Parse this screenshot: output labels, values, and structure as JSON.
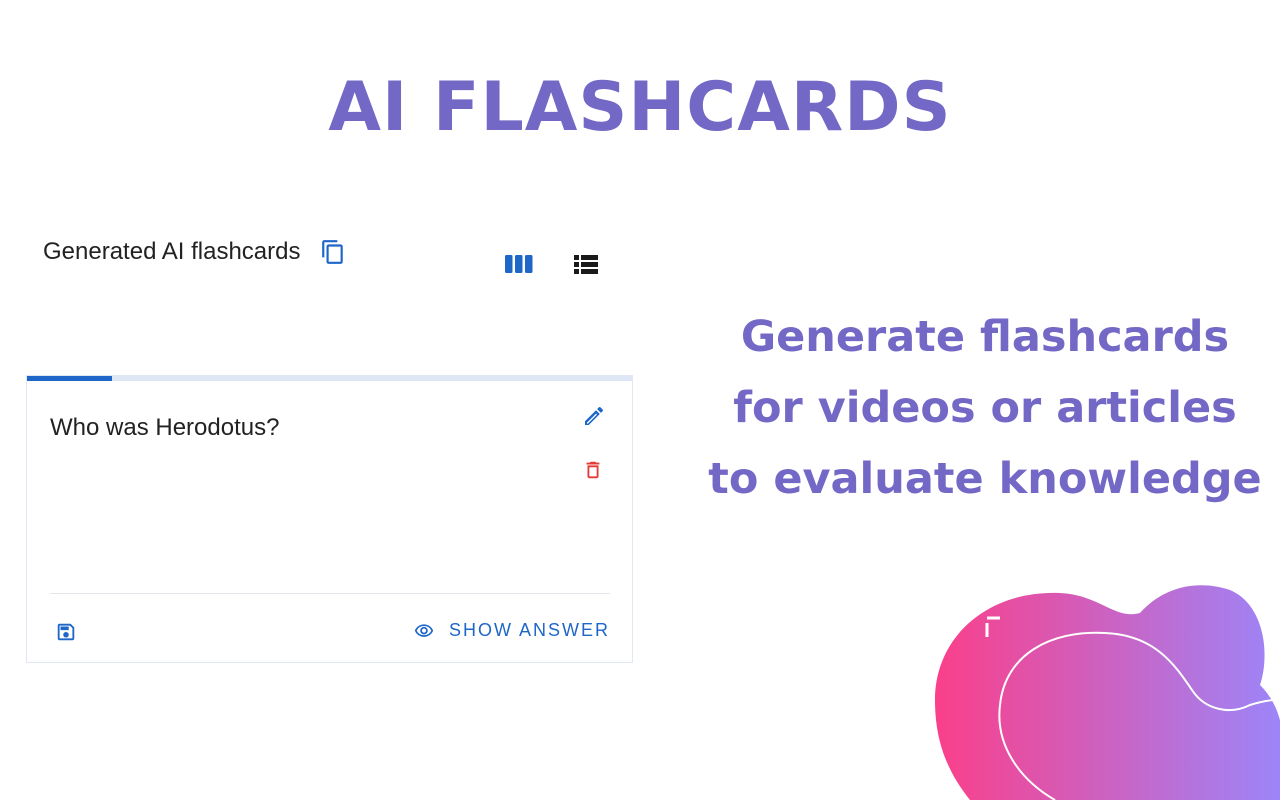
{
  "hero": {
    "title": "AI FLASHCARDS"
  },
  "panel": {
    "title": "Generated AI flashcards",
    "icons": {
      "copy": "copy-icon",
      "grid_view": "view-column-icon",
      "list_view": "view-list-icon"
    },
    "active_view": "grid"
  },
  "card": {
    "question": "Who was Herodotus?",
    "progress_percent": 14,
    "edit_icon": "pencil-icon",
    "delete_icon": "trash-icon",
    "save_icon": "save-icon",
    "show_answer_label": "SHOW ANSWER",
    "show_answer_icon": "eye-icon"
  },
  "tagline": {
    "lines": [
      "Generate flashcards",
      "for videos or articles",
      "to evaluate knowledge"
    ]
  },
  "colors": {
    "brand_purple": "#7468c6",
    "primary_blue": "#1e66c8",
    "danger_red": "#e53935",
    "blob_gradient_start": "#fb3f8a",
    "blob_gradient_end": "#9b86fa"
  }
}
